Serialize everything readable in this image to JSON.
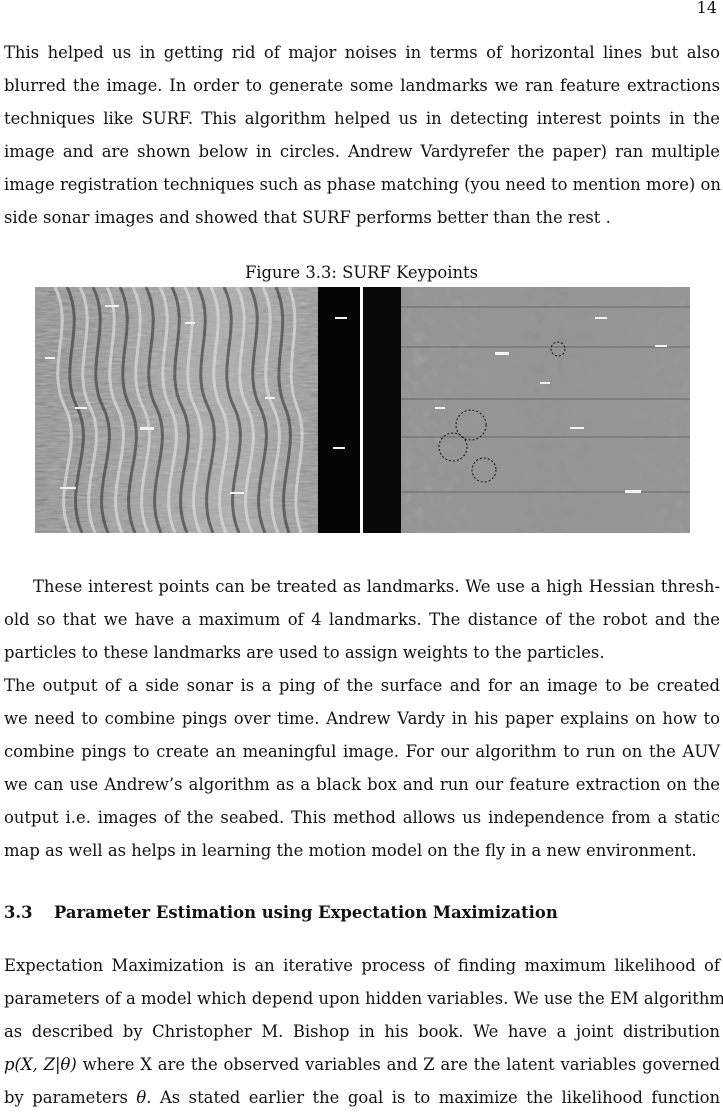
{
  "page_number": "14",
  "paragraph_1": [
    "This helped us in getting rid of major noises in terms of horizontal lines but also",
    "blurred the image. In order to generate some landmarks we ran feature extractions",
    "techniques like SURF. This algorithm helped us in detecting interest points in the",
    "image and are shown below in circles.  Andrew Vardyrefer the paper) ran multiple",
    "image registration techniques such as phase matching (you need to mention more) on",
    "side sonar images and showed that SURF performs better than the rest ."
  ],
  "figure": {
    "caption": "Figure 3.3: SURF Keypoints",
    "image_description": "side-scan sonar images with circled SURF keypoints"
  },
  "paragraph_2": [
    "These interest points can be treated as landmarks. We use a high Hessian thresh-",
    "old so that we have a maximum of 4 landmarks. The distance of the robot and the",
    "particles to these landmarks are used to assign weights to the particles."
  ],
  "paragraph_3": [
    "The output of a side sonar is a ping of the surface and for an image to be created",
    "we need to combine pings over time. Andrew Vardy in his paper explains on how to",
    "combine pings to create an meaningful image. For our algorithm to run on the AUV",
    "we can use Andrew’s algorithm as a black box and run our feature extraction on the",
    "output i.e. images of the seabed. This method allows us independence from a static",
    "map as well as helps in learning the motion model on the fly in a new environment."
  ],
  "section": {
    "number": "3.3",
    "title": "Parameter Estimation using Expectation Maximization"
  },
  "paragraph_4": [
    "Expectation Maximization is an iterative process of finding maximum likelihood of",
    "parameters of a model which depend upon hidden variables. We use the EM algorithm",
    "as described by Christopher M. Bishop in his book.  We have a joint distribution",
    "where X are the observed variables and Z are the latent variables governed",
    "by parameters",
    ".  As stated earlier the goal is to maximize the likelihood function"
  ],
  "math": {
    "joint": "p(X, Z|θ)",
    "theta": "θ"
  }
}
